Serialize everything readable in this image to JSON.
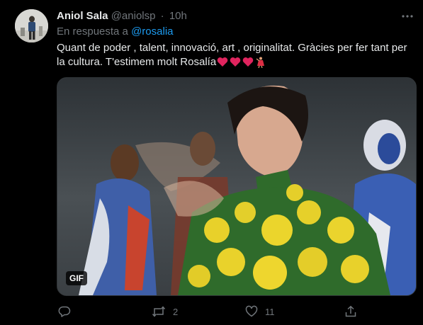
{
  "tweet": {
    "author_name": "Aniol Sala",
    "handle": "@aniolsp",
    "separator": "·",
    "time": "10h",
    "reply_prefix": "En respuesta a",
    "reply_mention": "@rosalia",
    "text": "Quant de poder , talent, innovació, art , originalitat. Gràcies per fer tant per la cultura. T'estimem molt Rosalía",
    "text_emojis": [
      "red-heart",
      "red-heart",
      "red-heart",
      "dancer"
    ],
    "media_badge": "GIF",
    "actions": {
      "reply_count": "",
      "retweet_count": "2",
      "like_count": "11",
      "share_count": ""
    }
  },
  "icons": {
    "more": "more-horizontal-icon",
    "reply": "reply-icon",
    "retweet": "retweet-icon",
    "like": "heart-icon",
    "share": "share-icon"
  },
  "colors": {
    "background": "#000000",
    "primary_text": "#e7e9ea",
    "secondary_text": "#71767b",
    "link": "#1d9bf0",
    "heart_emoji": "#e0245e"
  }
}
